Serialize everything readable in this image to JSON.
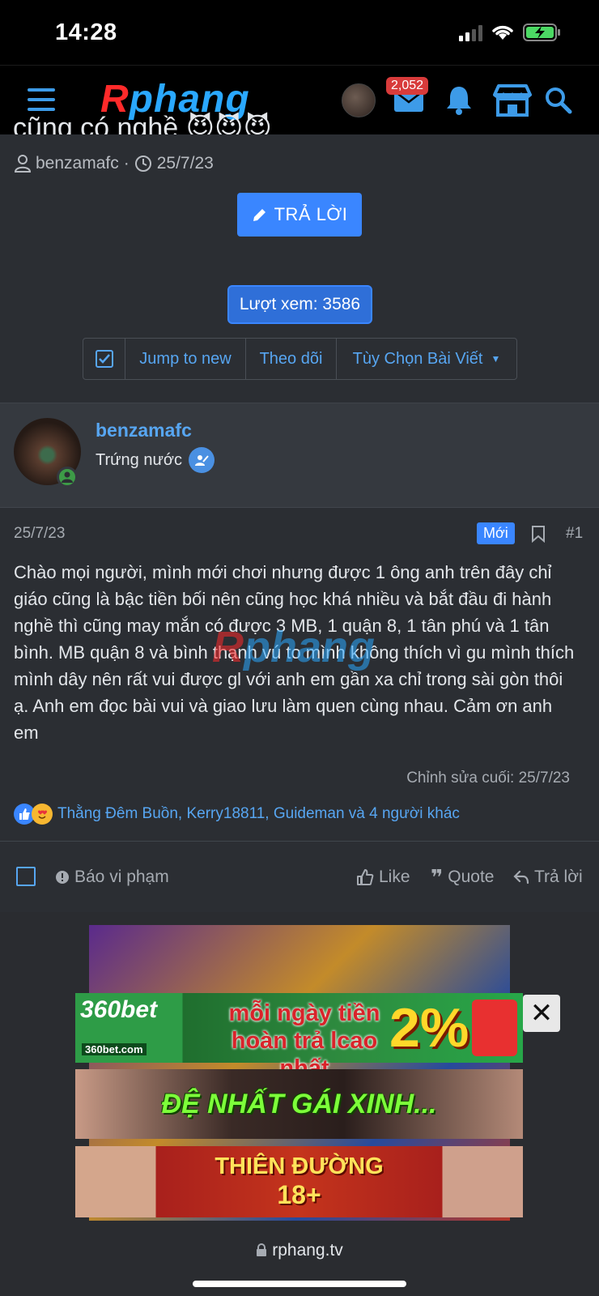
{
  "status_bar": {
    "time": "14:28"
  },
  "header": {
    "logo_part1": "R",
    "logo_part2": "phang",
    "mail_badge": "2,052"
  },
  "thread": {
    "title_fragment": "cũng có nghề 😈😈😈",
    "author": "benzamafc",
    "date": "25/7/23",
    "reply_label": "TRẢ LỜI",
    "views_label": "Lượt xem: 3586"
  },
  "toolbar": {
    "jump_label": "Jump to new",
    "follow_label": "Theo dõi",
    "options_label": "Tùy Chọn Bài Viết"
  },
  "post": {
    "username": "benzamafc",
    "user_title": "Trứng nước",
    "date": "25/7/23",
    "new_badge": "Mới",
    "number": "#1",
    "body": "Chào mọi người, mình mới chơi nhưng được 1 ông anh trên đây chỉ giáo cũng là bậc tiền bối nên cũng học khá nhiều và bắt đầu đi hành nghề thì cũng may mắn có được 3 MB, 1 quận 8, 1 tân phú và 1 tân bình. MB quận 8 và bình thạnh vú to mình không thích vì gu mình thích mình dây nên rất vui được gl với anh em gần xa chỉ trong sài gòn thôi ạ. Anh em đọc bài vui và giao lưu làm quen cùng nhau. Cảm ơn anh em",
    "last_edit": "Chỉnh sửa cuối: 25/7/23",
    "reactions": "Thằng Đêm Buồn, Kerry18811, Guideman và 4 người khác"
  },
  "post_footer": {
    "report_label": "Báo vi phạm",
    "like_label": "Like",
    "quote_label": "Quote",
    "reply_label": "Trả lời"
  },
  "ads": {
    "banner1_brand": "360bet",
    "banner1_domain": "360bet.com",
    "banner1_text": "mỗi ngày tiền hoàn trả lcao nhất",
    "banner1_percent": "2%",
    "banner2_text": "ĐỆ NHẤT GÁI XINH...",
    "banner3_line1": "THIÊN ĐƯỜNG",
    "banner3_line2": "18+"
  },
  "browser": {
    "url": "rphang.tv"
  },
  "colors": {
    "accent": "#3a86ff",
    "link": "#57a6f2",
    "background": "#2b2e33"
  }
}
